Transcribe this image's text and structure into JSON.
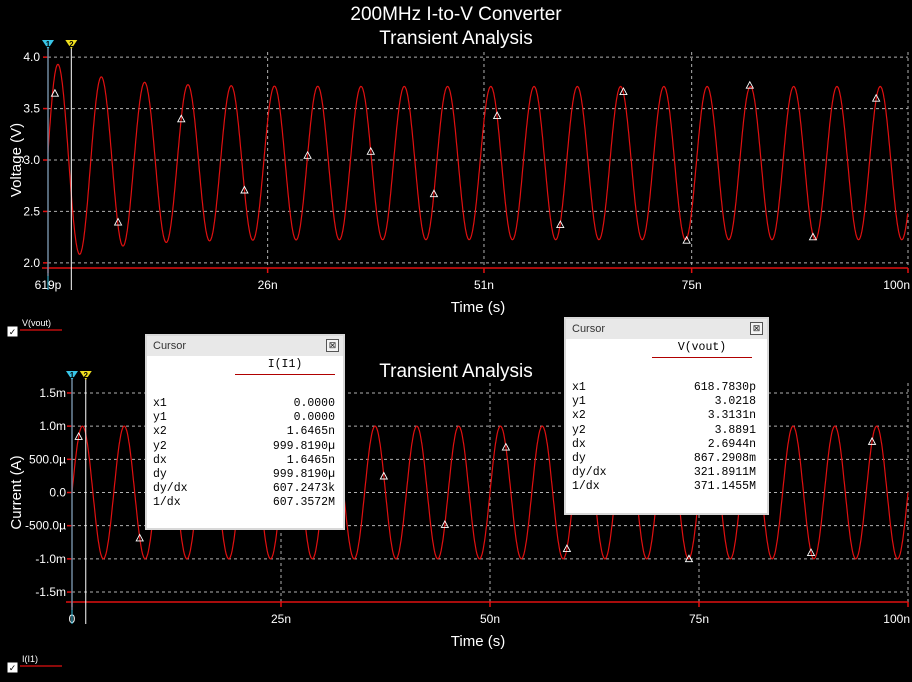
{
  "colors": {
    "background": "#000000",
    "trace": "#e01010",
    "axis": "#e01010",
    "grid": "#b0b0b0",
    "cursor1": "#39c6e8",
    "cursor2": "#f0e020",
    "text": "#ffffff"
  },
  "chart_data": [
    {
      "type": "line",
      "title": "200MHz I-to-V Converter",
      "subtitle": "Transient Analysis",
      "xlabel": "Time (s)",
      "ylabel": "Voltage (V)",
      "xlim_ns": [
        0.619,
        100
      ],
      "ylim": [
        1.95,
        4.05
      ],
      "x_ticks": [
        "619p",
        "26n",
        "51n",
        "75n",
        "100n"
      ],
      "y_ticks": [
        "2.0",
        "2.5",
        "3.0",
        "3.5",
        "4.0"
      ],
      "grid": true,
      "series": [
        {
          "name": "V(vout)",
          "frequency_hz": 200000000,
          "offset": 2.97,
          "amplitude": 0.76,
          "start_value": 2.97
        }
      ],
      "legend": "V(vout)",
      "cursors": [
        "1",
        "2"
      ]
    },
    {
      "type": "line",
      "title": "",
      "subtitle": "Transient Analysis",
      "xlabel": "Time (s)",
      "ylabel": "Current (A)",
      "xlim_ns": [
        0,
        100
      ],
      "ylim": [
        -0.00165,
        0.00165
      ],
      "x_ticks": [
        "0",
        "25n",
        "50n",
        "75n",
        "100n"
      ],
      "y_ticks": [
        "1.5m",
        "1.0m",
        "500.0µ",
        "0.0",
        "-500.0µ",
        "-1.0m",
        "-1.5m"
      ],
      "grid": true,
      "series": [
        {
          "name": "I(I1)",
          "frequency_hz": 200000000,
          "offset": 0,
          "amplitude": 0.001
        }
      ],
      "legend": "I(I1)",
      "cursors": [
        "1",
        "2"
      ]
    }
  ],
  "cursor_windows": [
    {
      "title": "Cursor",
      "close": "⊠",
      "signal": "I(I1)",
      "rows": [
        {
          "label": "x1",
          "value": "0.0000"
        },
        {
          "label": "y1",
          "value": "0.0000"
        },
        {
          "label": "x2",
          "value": "1.6465n"
        },
        {
          "label": "y2",
          "value": "999.8190µ"
        },
        {
          "label": "dx",
          "value": "1.6465n"
        },
        {
          "label": "dy",
          "value": "999.8190µ"
        },
        {
          "label": "dy/dx",
          "value": "607.2473k"
        },
        {
          "label": "1/dx",
          "value": "607.3572M"
        }
      ]
    },
    {
      "title": "Cursor",
      "close": "⊠",
      "signal": "V(vout)",
      "rows": [
        {
          "label": "x1",
          "value": "618.7830p"
        },
        {
          "label": "y1",
          "value": "3.0218"
        },
        {
          "label": "x2",
          "value": "3.3131n"
        },
        {
          "label": "y2",
          "value": "3.8891"
        },
        {
          "label": "dx",
          "value": "2.6944n"
        },
        {
          "label": "dy",
          "value": "867.2908m"
        },
        {
          "label": "dy/dx",
          "value": "321.8911M"
        },
        {
          "label": "1/dx",
          "value": "371.1455M"
        }
      ]
    }
  ]
}
